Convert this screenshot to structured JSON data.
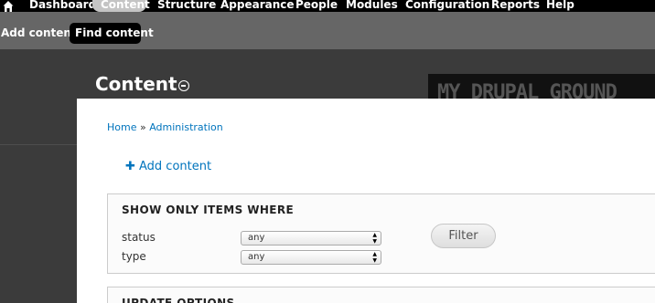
{
  "toolbar": {
    "items": [
      {
        "label": "Dashboard"
      },
      {
        "label": "Content"
      },
      {
        "label": "Structure"
      },
      {
        "label": "Appearance"
      },
      {
        "label": "People"
      },
      {
        "label": "Modules"
      },
      {
        "label": "Configuration"
      },
      {
        "label": "Reports"
      },
      {
        "label": "Help"
      }
    ],
    "active": "Content"
  },
  "shortcuts": {
    "items": [
      {
        "label": "Add content"
      },
      {
        "label": "Find content"
      }
    ],
    "active": "Find content"
  },
  "header": {
    "title": "Content",
    "logo_text": "MY DRUPAL GROUND"
  },
  "breadcrumb": {
    "items": [
      "Home",
      "Administration"
    ],
    "separator": "»"
  },
  "actions": {
    "add_content": "Add content"
  },
  "filters": {
    "legend": "SHOW ONLY ITEMS WHERE",
    "fields": [
      {
        "label": "status",
        "value": "any"
      },
      {
        "label": "type",
        "value": "any"
      }
    ],
    "filter_button": "Filter"
  },
  "update_options": {
    "legend": "UPDATE OPTIONS"
  },
  "colors": {
    "toolbar_bg": "#000000",
    "shortcuts_bg": "#666666",
    "header_bg": "#3b3b3b",
    "link": "#0074bd"
  }
}
